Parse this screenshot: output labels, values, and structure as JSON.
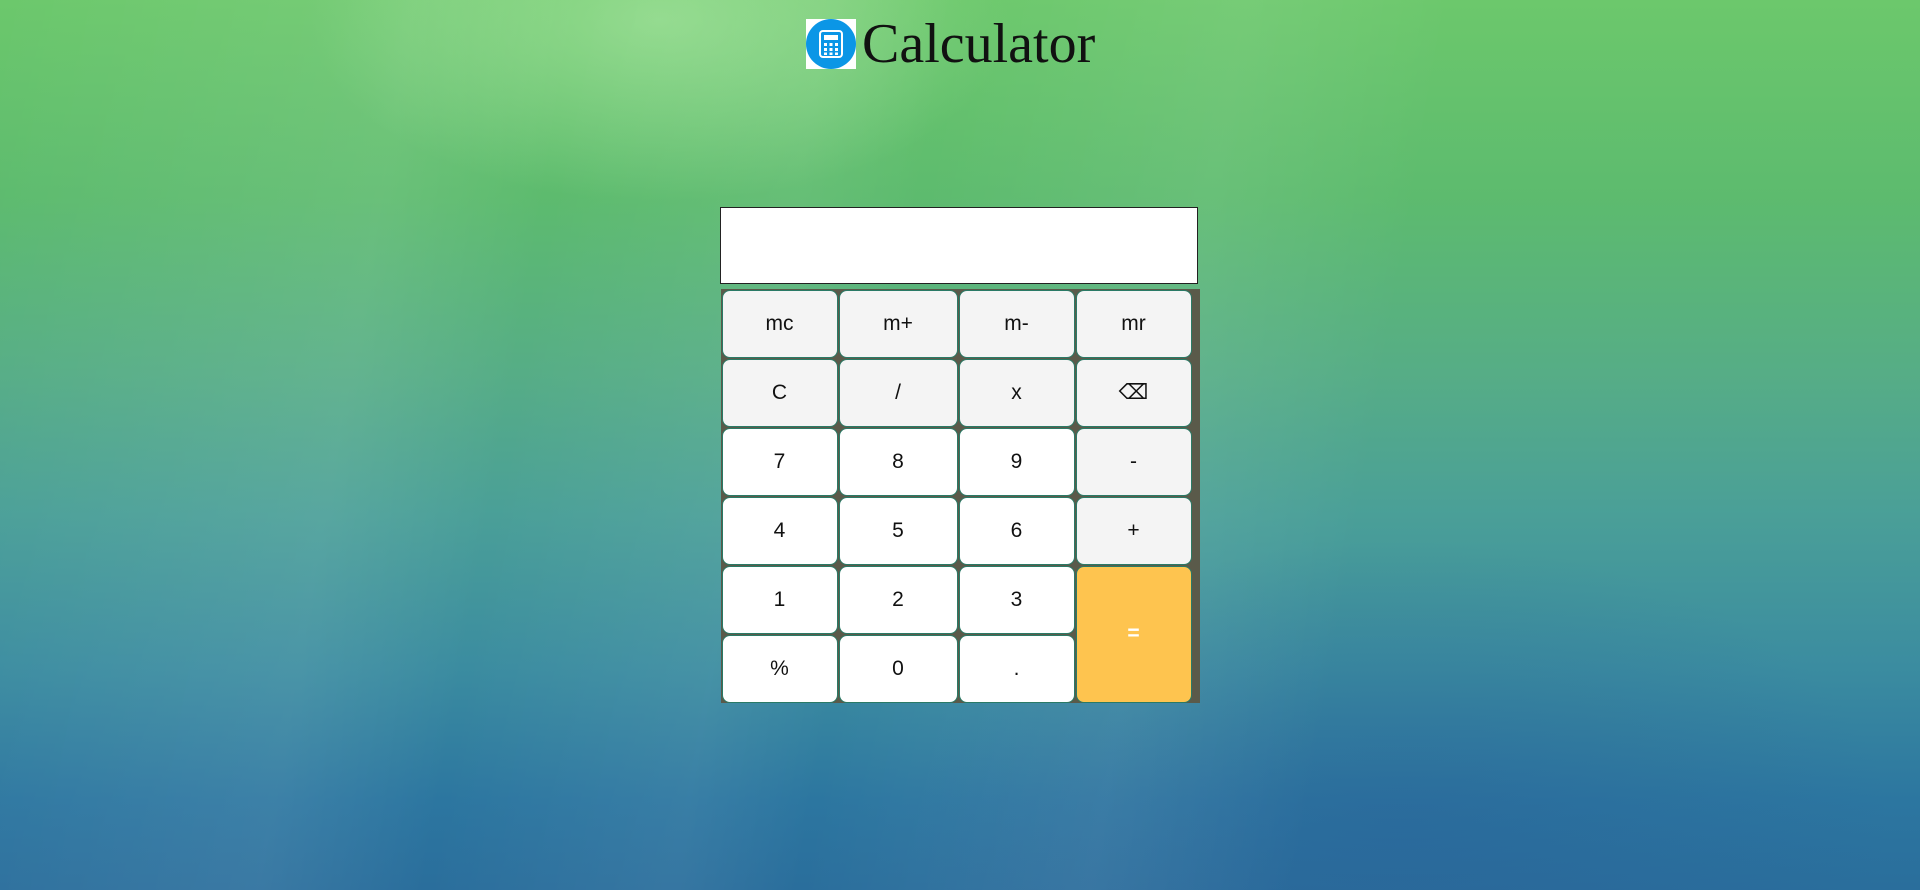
{
  "header": {
    "title": "Calculator",
    "logo_icon": "calculator-icon"
  },
  "display": {
    "value": ""
  },
  "keys": {
    "mc": "mc",
    "mplus": "m+",
    "mminus": "m-",
    "mr": "mr",
    "clear": "C",
    "divide": "/",
    "multiply": "x",
    "backspace": "⌫",
    "seven": "7",
    "eight": "8",
    "nine": "9",
    "minus": "-",
    "four": "4",
    "five": "5",
    "six": "6",
    "plus": "+",
    "one": "1",
    "two": "2",
    "three": "3",
    "equals": "=",
    "percent": "%",
    "zero": "0",
    "dot": "."
  },
  "colors": {
    "equals_key": "#fec44f",
    "logo_circle": "#0b96e6",
    "operator_key": "#f4f4f4",
    "digit_key": "#ffffff"
  }
}
